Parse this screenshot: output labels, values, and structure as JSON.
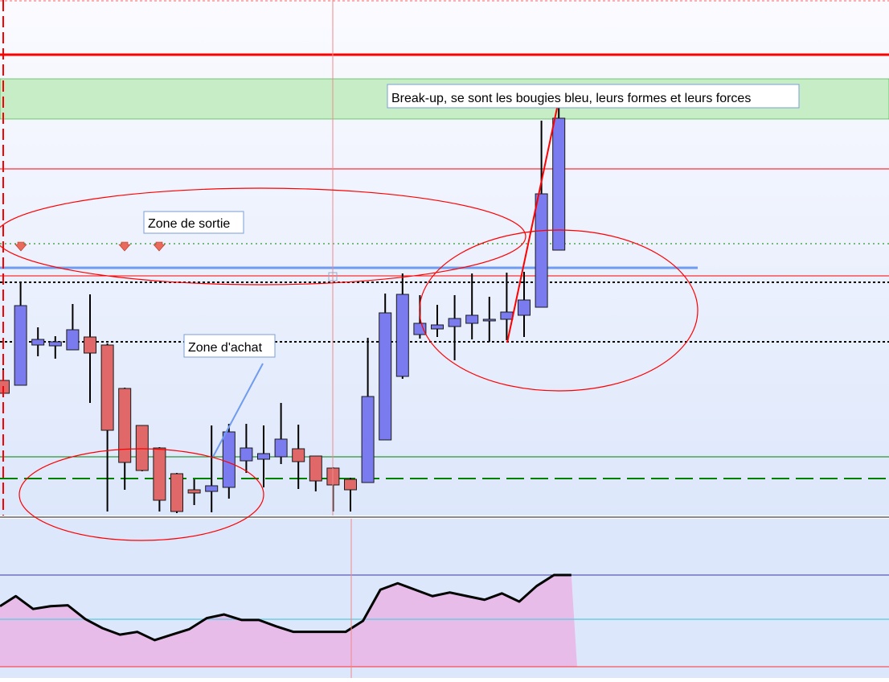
{
  "colors": {
    "bull": "#7b7bf0",
    "bear": "#e06868",
    "wick": "#000000",
    "resistance": "#ff0000",
    "support": "#008000",
    "blue_line": "#6f9cf0",
    "zone": "#c6edc6",
    "indicator_fill": "#e8bce9",
    "indicator_line": "#000000",
    "background_top": "#fbfbff",
    "background_bottom": "#dde7fb"
  },
  "annotations": {
    "breakout": "Break-up, se sont les bougies bleu, leurs formes et leurs forces",
    "exit_zone": "Zone de sortie",
    "buy_zone": "Zone d'achat"
  },
  "chart_data": [
    {
      "type": "candlestick",
      "title": "",
      "xlabel": "",
      "ylabel": "",
      "ylim": [
        0,
        643
      ],
      "grid": false,
      "candles": [
        {
          "o": 168,
          "h": 183,
          "l": 152,
          "c": 152
        },
        {
          "o": 162,
          "h": 289,
          "l": 162,
          "c": 261
        },
        {
          "o": 212,
          "h": 234,
          "l": 198,
          "c": 219
        },
        {
          "o": 211,
          "h": 223,
          "l": 195,
          "c": 216
        },
        {
          "o": 206,
          "h": 263,
          "l": 206,
          "c": 231
        },
        {
          "o": 222,
          "h": 275,
          "l": 140,
          "c": 202
        },
        {
          "o": 212,
          "h": 214,
          "l": 5,
          "c": 106
        },
        {
          "o": 158,
          "h": 159,
          "l": 32,
          "c": 66
        },
        {
          "o": 112,
          "h": 112,
          "l": 55,
          "c": 56
        },
        {
          "o": 84,
          "h": 85,
          "l": 5,
          "c": 19
        },
        {
          "o": 52,
          "h": 53,
          "l": 3,
          "c": 5
        },
        {
          "o": 32,
          "h": 45,
          "l": 13,
          "c": 28
        },
        {
          "o": 30,
          "h": 112,
          "l": 4,
          "c": 37
        },
        {
          "o": 35,
          "h": 114,
          "l": 21,
          "c": 104
        },
        {
          "o": 68,
          "h": 114,
          "l": 53,
          "c": 84
        },
        {
          "o": 70,
          "h": 112,
          "l": 35,
          "c": 77
        },
        {
          "o": 73,
          "h": 140,
          "l": 64,
          "c": 95
        },
        {
          "o": 83,
          "h": 113,
          "l": 33,
          "c": 67
        },
        {
          "o": 74,
          "h": 74,
          "l": 30,
          "c": 43
        },
        {
          "o": 59,
          "h": 60,
          "l": 5,
          "c": 38
        },
        {
          "o": 45,
          "h": 47,
          "l": 5,
          "c": 32
        },
        {
          "o": 41,
          "h": 221,
          "l": 41,
          "c": 148
        },
        {
          "o": 94,
          "h": 276,
          "l": 94,
          "c": 252
        },
        {
          "o": 173,
          "h": 301,
          "l": 170,
          "c": 275
        },
        {
          "o": 225,
          "h": 274,
          "l": 220,
          "c": 239
        },
        {
          "o": 232,
          "h": 262,
          "l": 222,
          "c": 237
        },
        {
          "o": 235,
          "h": 274,
          "l": 193,
          "c": 245
        },
        {
          "o": 239,
          "h": 301,
          "l": 219,
          "c": 249
        },
        {
          "o": 244,
          "h": 272,
          "l": 216,
          "c": 244
        },
        {
          "o": 244,
          "h": 302,
          "l": 218,
          "c": 253
        },
        {
          "o": 249,
          "h": 303,
          "l": 222,
          "c": 268
        },
        {
          "o": 259,
          "h": 491,
          "l": 259,
          "c": 400
        },
        {
          "o": 330,
          "h": 517,
          "l": 330,
          "c": 494
        }
      ],
      "levels": [
        {
          "y": 573,
          "style": "solid-thick",
          "color": "resistance"
        },
        {
          "y": 431,
          "style": "solid",
          "color": "resistance"
        },
        {
          "y": 298,
          "style": "solid",
          "color": "resistance"
        },
        {
          "y": 338,
          "style": "dotted",
          "color": "support"
        },
        {
          "y": 290,
          "style": "dotted",
          "color": "wick"
        },
        {
          "y": 216,
          "style": "dotted",
          "color": "wick"
        },
        {
          "y": 73,
          "style": "solid",
          "color": "support"
        },
        {
          "y": 46,
          "style": "dashed-thick",
          "color": "support"
        },
        {
          "y": 308,
          "style": "solid-thick",
          "color": "blue_line"
        }
      ],
      "zone": {
        "from": 493,
        "to": 543
      }
    },
    {
      "type": "area",
      "title": "",
      "ylim": [
        0,
        100
      ],
      "values": [
        66,
        77,
        63,
        66,
        67,
        52,
        42,
        35,
        38,
        29,
        35,
        41,
        53,
        57,
        51,
        51,
        44,
        38,
        38,
        38,
        38,
        50,
        84,
        91,
        84,
        77,
        81,
        77,
        73,
        80,
        71,
        88,
        100,
        100
      ]
    }
  ]
}
